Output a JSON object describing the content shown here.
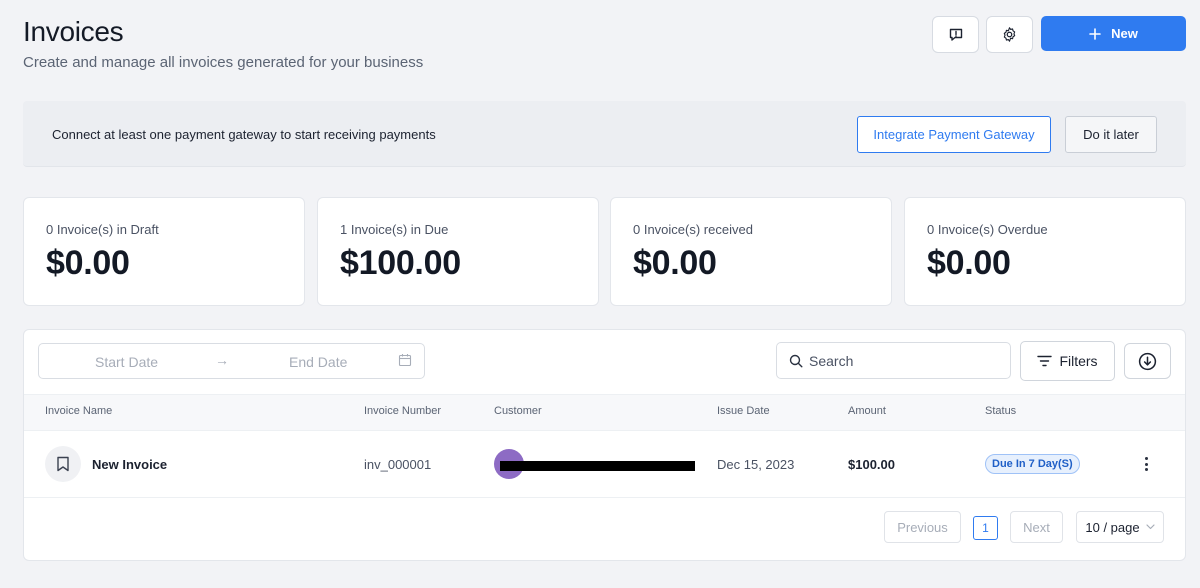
{
  "header": {
    "title": "Invoices",
    "subtitle": "Create and manage all invoices generated for your business",
    "new_label": "New"
  },
  "banner": {
    "message": "Connect at least one payment gateway to start receiving payments",
    "integrate_label": "Integrate Payment Gateway",
    "later_label": "Do it later"
  },
  "stats": [
    {
      "label": "0 Invoice(s) in Draft",
      "value": "$0.00"
    },
    {
      "label": "1 Invoice(s) in Due",
      "value": "$100.00"
    },
    {
      "label": "0 Invoice(s) received",
      "value": "$0.00"
    },
    {
      "label": "0 Invoice(s) Overdue",
      "value": "$0.00"
    }
  ],
  "filters": {
    "start_date_placeholder": "Start Date",
    "end_date_placeholder": "End Date",
    "search_placeholder": "Search",
    "filters_label": "Filters"
  },
  "table": {
    "columns": [
      "Invoice Name",
      "Invoice Number",
      "Customer",
      "Issue Date",
      "Amount",
      "Status"
    ],
    "rows": [
      {
        "name": "New Invoice",
        "number": "inv_000001",
        "issue_date": "Dec 15, 2023",
        "amount": "$100.00",
        "status": "Due In 7 Day(S)"
      }
    ]
  },
  "pagination": {
    "previous_label": "Previous",
    "current_page": "1",
    "next_label": "Next",
    "page_size": "10 / page"
  },
  "colors": {
    "primary": "#2f7bf0",
    "avatar": "#8d6bc4",
    "status_bg": "#e7f0fd"
  }
}
